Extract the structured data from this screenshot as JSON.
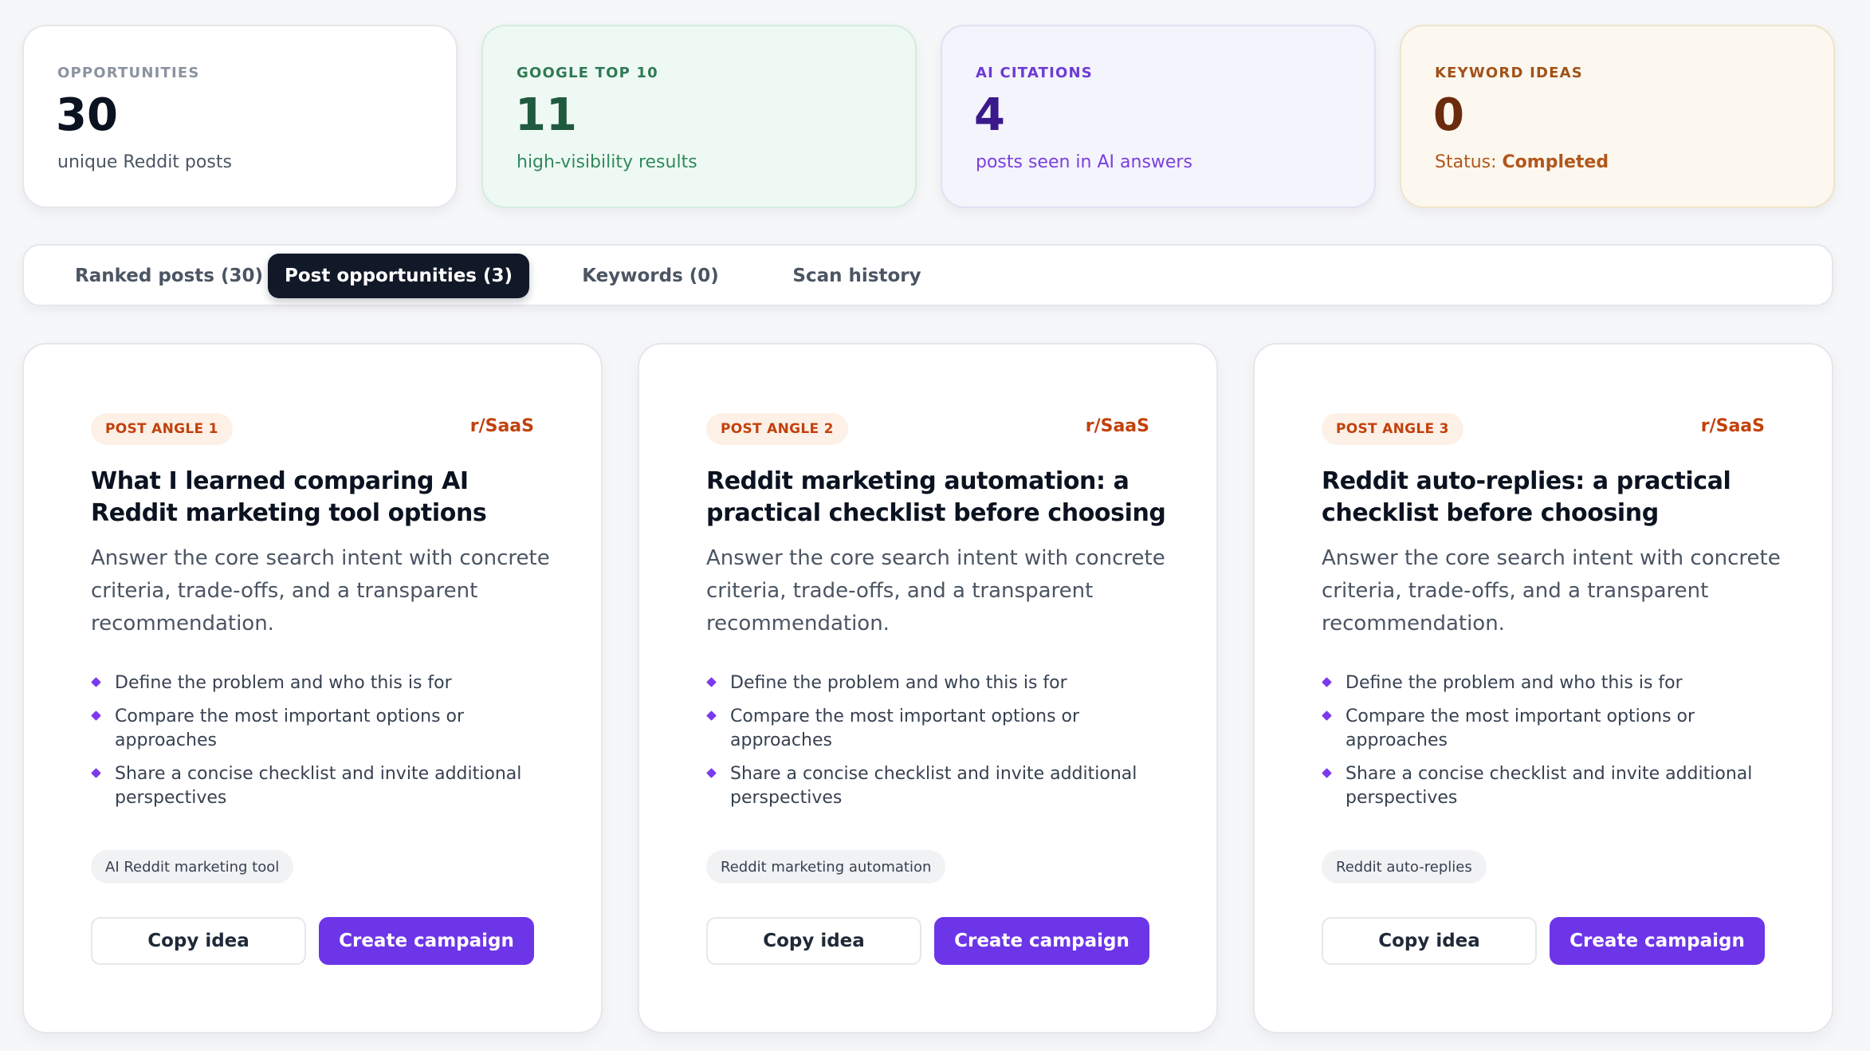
{
  "stats": [
    {
      "label": "OPPORTUNITIES",
      "value": "30",
      "sub": "unique Reddit posts"
    },
    {
      "label": "GOOGLE TOP 10",
      "value": "11",
      "sub": "high-visibility results"
    },
    {
      "label": "AI CITATIONS",
      "value": "4",
      "sub": "posts seen in AI answers"
    },
    {
      "label": "KEYWORD IDEAS",
      "value": "0",
      "sub_prefix": "Status: ",
      "sub_status": "Completed"
    }
  ],
  "tabs": [
    {
      "label": "Ranked posts (30)",
      "active": false
    },
    {
      "label": "Post opportunities (3)",
      "active": true
    },
    {
      "label": "Keywords (0)",
      "active": false
    },
    {
      "label": "Scan history",
      "active": false
    }
  ],
  "cards": [
    {
      "badge": "POST ANGLE 1",
      "subreddit": "r/SaaS",
      "title": "What I learned comparing AI Reddit marketing tool options",
      "description": "Answer the core search intent with concrete criteria, trade-offs, and a transparent recommendation.",
      "bullets": [
        "Define the problem and who this is for",
        "Compare the most important options or approaches",
        "Share a concise checklist and invite additional perspectives"
      ],
      "keyword": "AI Reddit marketing tool",
      "copy_label": "Copy idea",
      "create_label": "Create campaign"
    },
    {
      "badge": "POST ANGLE 2",
      "subreddit": "r/SaaS",
      "title": "Reddit marketing automation: a practical checklist before choosing",
      "description": "Answer the core search intent with concrete criteria, trade-offs, and a transparent recommendation.",
      "bullets": [
        "Define the problem and who this is for",
        "Compare the most important options or approaches",
        "Share a concise checklist and invite additional perspectives"
      ],
      "keyword": "Reddit marketing automation",
      "copy_label": "Copy idea",
      "create_label": "Create campaign"
    },
    {
      "badge": "POST ANGLE 3",
      "subreddit": "r/SaaS",
      "title": "Reddit auto-replies: a practical checklist before choosing",
      "description": "Answer the core search intent with concrete criteria, trade-offs, and a transparent recommendation.",
      "bullets": [
        "Define the problem and who this is for",
        "Compare the most important options or approaches",
        "Share a concise checklist and invite additional perspectives"
      ],
      "keyword": "Reddit auto-replies",
      "copy_label": "Copy idea",
      "create_label": "Create campaign"
    }
  ],
  "colors": {
    "accent": "#6d35e8",
    "tab_active_bg": "#111827",
    "badge_text": "#c2410c",
    "bullet_marker": "#7c3aed"
  },
  "icons": {
    "bullet": "diamond-bullet-icon"
  }
}
